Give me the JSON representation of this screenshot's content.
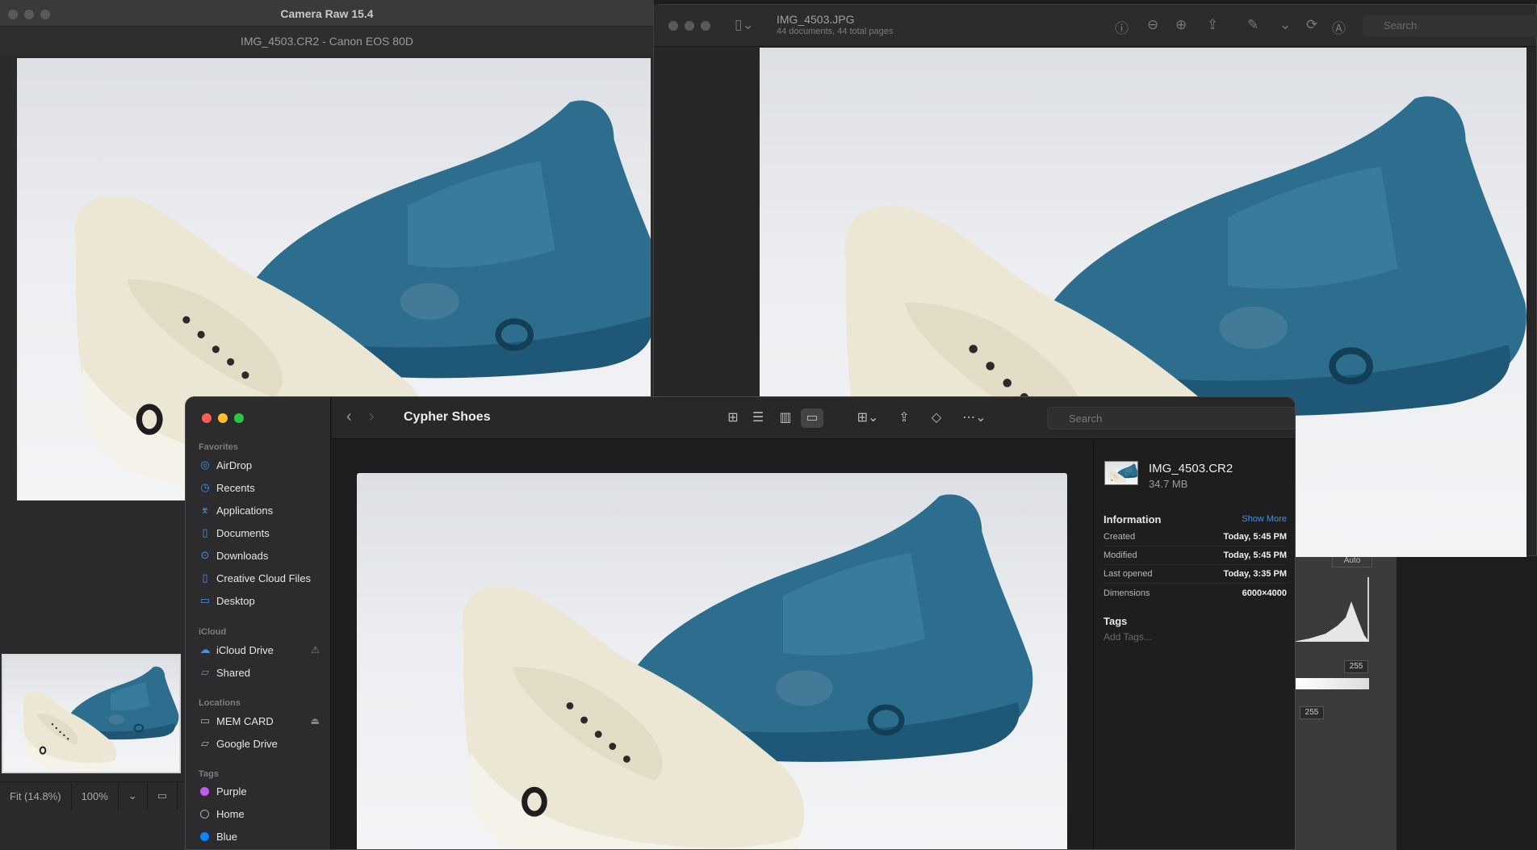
{
  "camera_raw": {
    "window_title": "Camera Raw 15.4",
    "file_info": "IMG_4503.CR2  -  Canon EOS 80D",
    "zoom_fit": "Fit (14.8%)",
    "zoom_pct": "100%",
    "panel": {
      "auto_label": "Auto",
      "white_value": "255",
      "output_value": "255"
    }
  },
  "preview": {
    "doc_title": "IMG_4503.JPG",
    "doc_subtitle": "44 documents, 44 total pages",
    "search_placeholder": "Search"
  },
  "finder": {
    "folder_title": "Cypher Shoes",
    "search_placeholder": "Search",
    "sidebar": {
      "favorites_header": "Favorites",
      "favorites": [
        {
          "label": "AirDrop",
          "icon": "airdrop-icon"
        },
        {
          "label": "Recents",
          "icon": "clock-icon"
        },
        {
          "label": "Applications",
          "icon": "applications-icon"
        },
        {
          "label": "Documents",
          "icon": "document-icon"
        },
        {
          "label": "Downloads",
          "icon": "download-icon"
        },
        {
          "label": "Creative Cloud Files",
          "icon": "document-icon"
        },
        {
          "label": "Desktop",
          "icon": "desktop-icon"
        }
      ],
      "icloud_header": "iCloud",
      "icloud": [
        {
          "label": "iCloud Drive",
          "icon": "cloud-icon"
        },
        {
          "label": "Shared",
          "icon": "shared-folder-icon"
        }
      ],
      "locations_header": "Locations",
      "locations": [
        {
          "label": "MEM CARD",
          "icon": "drive-icon"
        },
        {
          "label": "Google Drive",
          "icon": "folder-icon"
        }
      ],
      "tags_header": "Tags",
      "tags": [
        {
          "label": "Purple",
          "color": "#bf5af2"
        },
        {
          "label": "Home",
          "color": "transparent"
        },
        {
          "label": "Blue",
          "color": "#0a84ff"
        }
      ]
    },
    "inspector": {
      "file_name": "IMG_4503.CR2",
      "file_size": "34.7 MB",
      "info_header": "Information",
      "show_more": "Show More",
      "rows": [
        {
          "key": "Created",
          "value": "Today, 5:45 PM"
        },
        {
          "key": "Modified",
          "value": "Today, 5:45 PM"
        },
        {
          "key": "Last opened",
          "value": "Today, 3:35 PM"
        },
        {
          "key": "Dimensions",
          "value": "6000×4000"
        }
      ],
      "tags_header": "Tags",
      "tags_placeholder": "Add Tags..."
    }
  }
}
